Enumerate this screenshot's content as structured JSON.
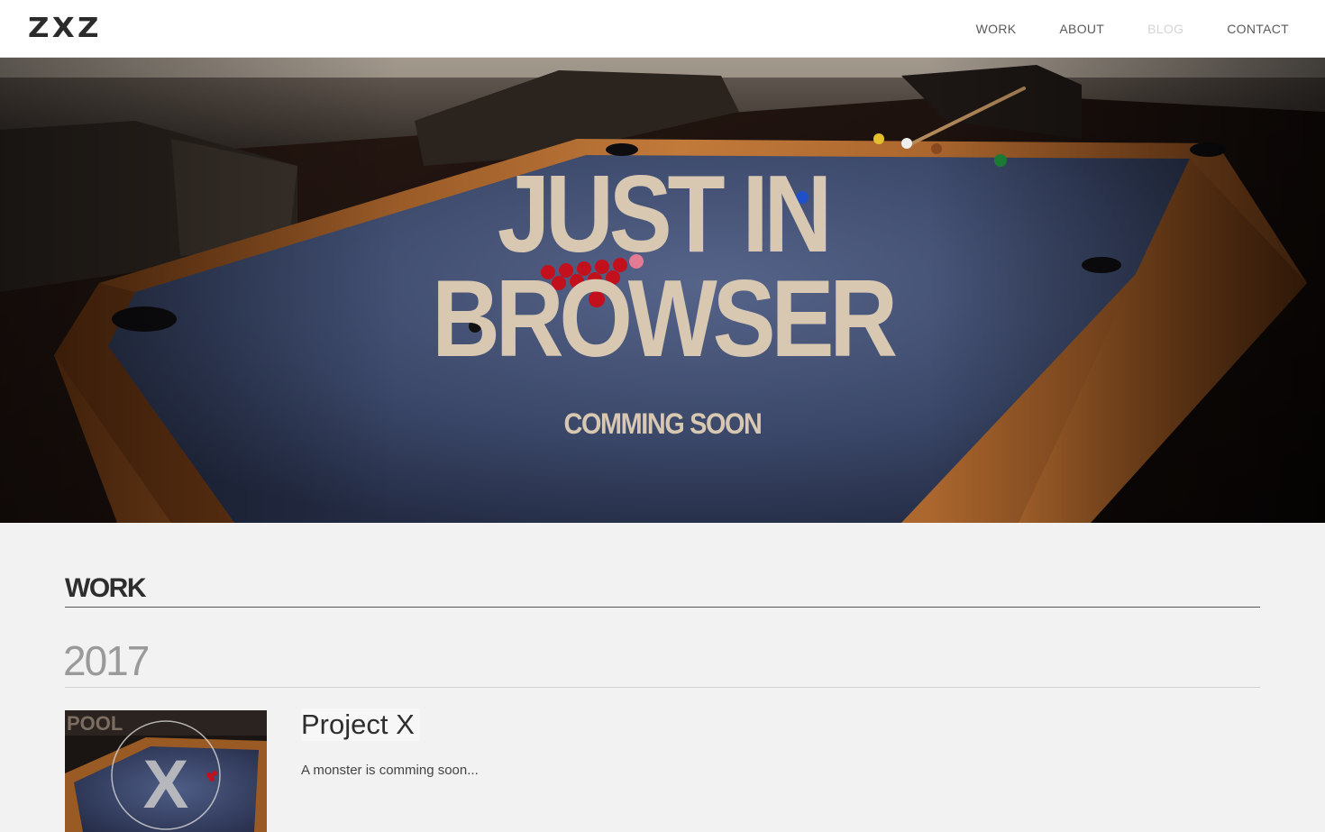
{
  "header": {
    "logo": "ZXZ",
    "nav": [
      {
        "label": "WORK",
        "state": "normal"
      },
      {
        "label": "ABOUT",
        "state": "normal"
      },
      {
        "label": "BLOG",
        "state": "muted"
      },
      {
        "label": "CONTACT",
        "state": "normal"
      }
    ]
  },
  "hero": {
    "title_line1": "JUST IN",
    "title_line2": "BROWSER",
    "subtitle": "COMMING SOON",
    "text_color": "#d8c8b2",
    "felt_color": "#3b4868",
    "wood_color": "#a8642a"
  },
  "work": {
    "section_title": "WORK",
    "year": "2017",
    "projects": [
      {
        "title": "Project X",
        "description": "A monster is comming soon...",
        "thumb_overlay_letter": "X",
        "thumb_sign_text": "POOL"
      }
    ]
  }
}
